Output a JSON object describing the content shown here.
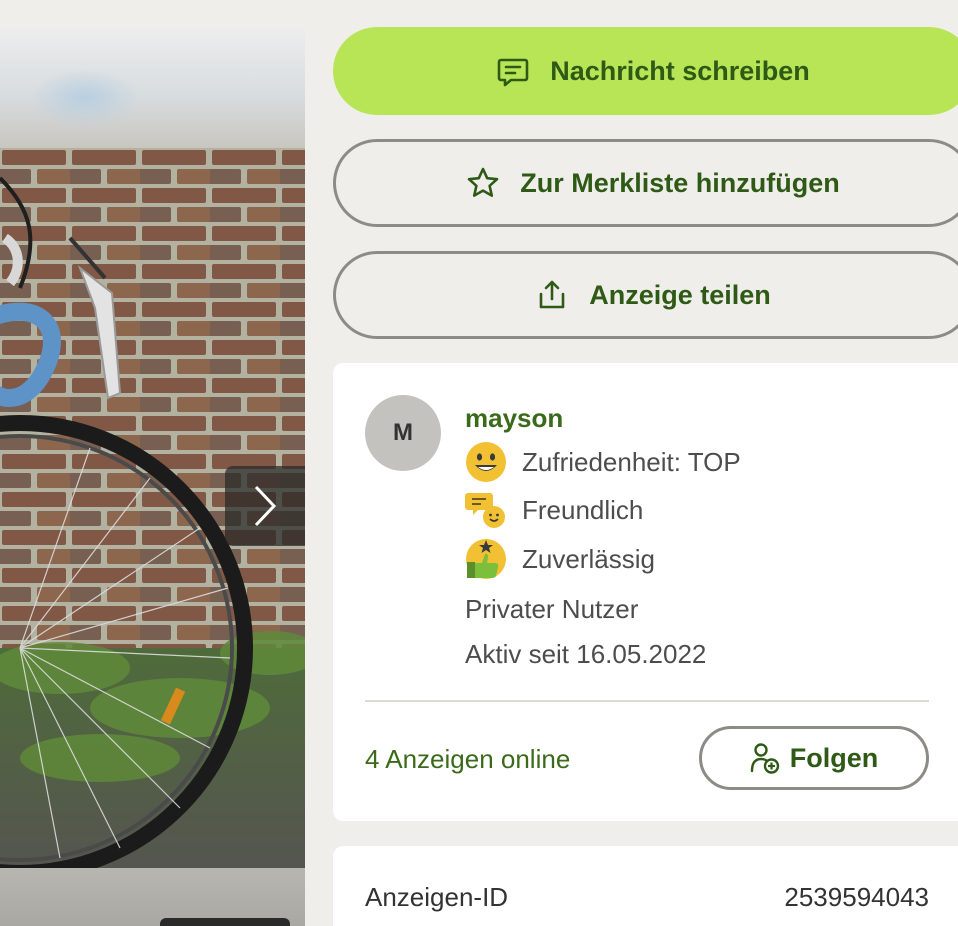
{
  "gallery": {
    "image_subject": "racing bicycle in front of brick wall",
    "next_icon": "chevron-right-icon"
  },
  "actions": {
    "message": {
      "label": "Nachricht schreiben",
      "icon": "message-icon"
    },
    "watchlist": {
      "label": "Zur Merkliste hinzufügen",
      "icon": "star-icon"
    },
    "share": {
      "label": "Anzeige teilen",
      "icon": "share-icon"
    }
  },
  "seller": {
    "avatar_initial": "M",
    "name": "mayson",
    "badges": [
      {
        "label": "Zufriedenheit: TOP",
        "icon": "smiley-icon"
      },
      {
        "label": "Freundlich",
        "icon": "chat-bubbles-icon"
      },
      {
        "label": "Zuverlässig",
        "icon": "thumbs-up-icon"
      }
    ],
    "type": "Privater Nutzer",
    "active_since": "Aktiv seit 16.05.2022",
    "ads_online": "4 Anzeigen online",
    "follow_label": "Folgen",
    "follow_icon": "add-user-icon"
  },
  "ad_info": {
    "id_label": "Anzeigen-ID",
    "id_value": "2539594043"
  },
  "colors": {
    "primary": "#b8e556",
    "brand_text": "#2f5a16",
    "link_green": "#3b6b1a",
    "background": "#efeeeb",
    "border": "#8d8b86"
  }
}
